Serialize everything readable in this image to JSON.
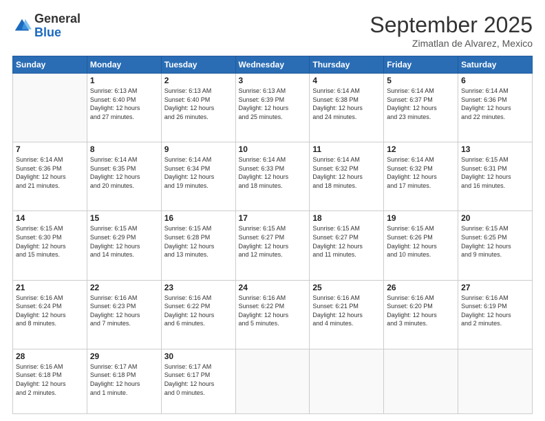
{
  "header": {
    "logo_general": "General",
    "logo_blue": "Blue",
    "month_title": "September 2025",
    "subtitle": "Zimatlan de Alvarez, Mexico"
  },
  "days_of_week": [
    "Sunday",
    "Monday",
    "Tuesday",
    "Wednesday",
    "Thursday",
    "Friday",
    "Saturday"
  ],
  "weeks": [
    [
      {
        "day": "",
        "info": ""
      },
      {
        "day": "1",
        "info": "Sunrise: 6:13 AM\nSunset: 6:40 PM\nDaylight: 12 hours\nand 27 minutes."
      },
      {
        "day": "2",
        "info": "Sunrise: 6:13 AM\nSunset: 6:40 PM\nDaylight: 12 hours\nand 26 minutes."
      },
      {
        "day": "3",
        "info": "Sunrise: 6:13 AM\nSunset: 6:39 PM\nDaylight: 12 hours\nand 25 minutes."
      },
      {
        "day": "4",
        "info": "Sunrise: 6:14 AM\nSunset: 6:38 PM\nDaylight: 12 hours\nand 24 minutes."
      },
      {
        "day": "5",
        "info": "Sunrise: 6:14 AM\nSunset: 6:37 PM\nDaylight: 12 hours\nand 23 minutes."
      },
      {
        "day": "6",
        "info": "Sunrise: 6:14 AM\nSunset: 6:36 PM\nDaylight: 12 hours\nand 22 minutes."
      }
    ],
    [
      {
        "day": "7",
        "info": "Sunrise: 6:14 AM\nSunset: 6:36 PM\nDaylight: 12 hours\nand 21 minutes."
      },
      {
        "day": "8",
        "info": "Sunrise: 6:14 AM\nSunset: 6:35 PM\nDaylight: 12 hours\nand 20 minutes."
      },
      {
        "day": "9",
        "info": "Sunrise: 6:14 AM\nSunset: 6:34 PM\nDaylight: 12 hours\nand 19 minutes."
      },
      {
        "day": "10",
        "info": "Sunrise: 6:14 AM\nSunset: 6:33 PM\nDaylight: 12 hours\nand 18 minutes."
      },
      {
        "day": "11",
        "info": "Sunrise: 6:14 AM\nSunset: 6:32 PM\nDaylight: 12 hours\nand 18 minutes."
      },
      {
        "day": "12",
        "info": "Sunrise: 6:14 AM\nSunset: 6:32 PM\nDaylight: 12 hours\nand 17 minutes."
      },
      {
        "day": "13",
        "info": "Sunrise: 6:15 AM\nSunset: 6:31 PM\nDaylight: 12 hours\nand 16 minutes."
      }
    ],
    [
      {
        "day": "14",
        "info": "Sunrise: 6:15 AM\nSunset: 6:30 PM\nDaylight: 12 hours\nand 15 minutes."
      },
      {
        "day": "15",
        "info": "Sunrise: 6:15 AM\nSunset: 6:29 PM\nDaylight: 12 hours\nand 14 minutes."
      },
      {
        "day": "16",
        "info": "Sunrise: 6:15 AM\nSunset: 6:28 PM\nDaylight: 12 hours\nand 13 minutes."
      },
      {
        "day": "17",
        "info": "Sunrise: 6:15 AM\nSunset: 6:27 PM\nDaylight: 12 hours\nand 12 minutes."
      },
      {
        "day": "18",
        "info": "Sunrise: 6:15 AM\nSunset: 6:27 PM\nDaylight: 12 hours\nand 11 minutes."
      },
      {
        "day": "19",
        "info": "Sunrise: 6:15 AM\nSunset: 6:26 PM\nDaylight: 12 hours\nand 10 minutes."
      },
      {
        "day": "20",
        "info": "Sunrise: 6:15 AM\nSunset: 6:25 PM\nDaylight: 12 hours\nand 9 minutes."
      }
    ],
    [
      {
        "day": "21",
        "info": "Sunrise: 6:16 AM\nSunset: 6:24 PM\nDaylight: 12 hours\nand 8 minutes."
      },
      {
        "day": "22",
        "info": "Sunrise: 6:16 AM\nSunset: 6:23 PM\nDaylight: 12 hours\nand 7 minutes."
      },
      {
        "day": "23",
        "info": "Sunrise: 6:16 AM\nSunset: 6:22 PM\nDaylight: 12 hours\nand 6 minutes."
      },
      {
        "day": "24",
        "info": "Sunrise: 6:16 AM\nSunset: 6:22 PM\nDaylight: 12 hours\nand 5 minutes."
      },
      {
        "day": "25",
        "info": "Sunrise: 6:16 AM\nSunset: 6:21 PM\nDaylight: 12 hours\nand 4 minutes."
      },
      {
        "day": "26",
        "info": "Sunrise: 6:16 AM\nSunset: 6:20 PM\nDaylight: 12 hours\nand 3 minutes."
      },
      {
        "day": "27",
        "info": "Sunrise: 6:16 AM\nSunset: 6:19 PM\nDaylight: 12 hours\nand 2 minutes."
      }
    ],
    [
      {
        "day": "28",
        "info": "Sunrise: 6:16 AM\nSunset: 6:18 PM\nDaylight: 12 hours\nand 2 minutes."
      },
      {
        "day": "29",
        "info": "Sunrise: 6:17 AM\nSunset: 6:18 PM\nDaylight: 12 hours\nand 1 minute."
      },
      {
        "day": "30",
        "info": "Sunrise: 6:17 AM\nSunset: 6:17 PM\nDaylight: 12 hours\nand 0 minutes."
      },
      {
        "day": "",
        "info": ""
      },
      {
        "day": "",
        "info": ""
      },
      {
        "day": "",
        "info": ""
      },
      {
        "day": "",
        "info": ""
      }
    ]
  ]
}
